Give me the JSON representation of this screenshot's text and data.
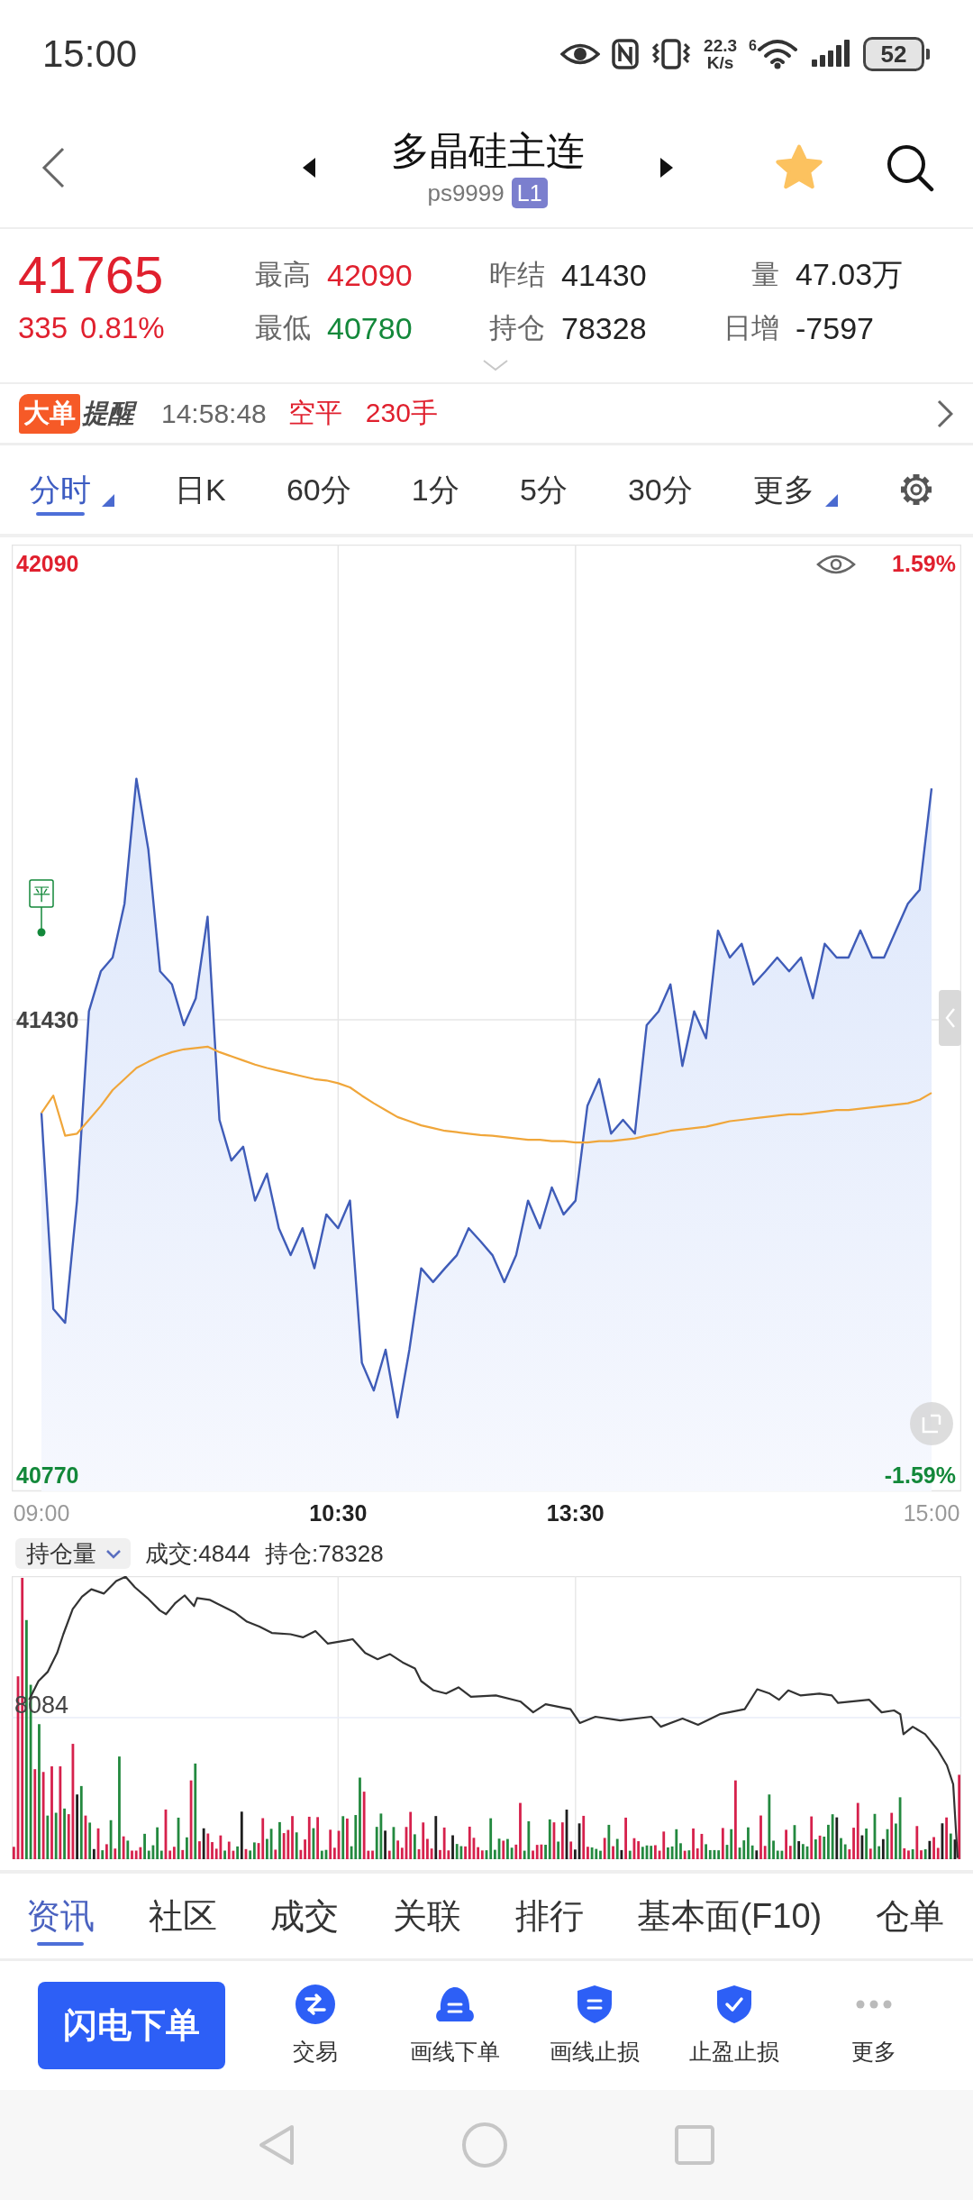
{
  "status_bar": {
    "time": "15:00",
    "network_speed": [
      "22.3",
      "K/s"
    ],
    "wifi_badge": "6",
    "battery": "52"
  },
  "header": {
    "title": "多晶硅主连",
    "code": "ps9999",
    "level_badge": "L1",
    "favorite": true
  },
  "quote": {
    "price": "41765",
    "change": "335",
    "change_percent": "0.81%",
    "color": "#e0202e",
    "stats": [
      {
        "label": "最高",
        "value": "42090",
        "color": "#e0202e"
      },
      {
        "label": "昨结",
        "value": "41430",
        "color": "#222222"
      },
      {
        "label": "量",
        "value": "47.03万",
        "color": "#222222"
      },
      {
        "label": "最低",
        "value": "40780",
        "color": "#13883a"
      },
      {
        "label": "持仓",
        "value": "78328",
        "color": "#222222"
      },
      {
        "label": "日增",
        "value": "-7597",
        "color": "#222222"
      }
    ]
  },
  "alert": {
    "logo": [
      "大单",
      "提醒"
    ],
    "time": "14:58:48",
    "action": "空平",
    "volume": "230手"
  },
  "period_tabs": [
    {
      "label": "分时",
      "selected": true,
      "has_menu": true
    },
    {
      "label": "日K",
      "selected": false,
      "has_menu": false
    },
    {
      "label": "60分",
      "selected": false,
      "has_menu": false
    },
    {
      "label": "1分",
      "selected": false,
      "has_menu": false
    },
    {
      "label": "5分",
      "selected": false,
      "has_menu": false
    },
    {
      "label": "30分",
      "selected": false,
      "has_menu": false
    },
    {
      "label": "更多",
      "selected": false,
      "has_menu": true
    }
  ],
  "intraday_chart": {
    "right_labels": [
      {
        "text": "1.59%",
        "color": "#e0202e"
      },
      {
        "text": "-1.59%",
        "color": "#13883a"
      }
    ],
    "chart_data": {
      "type": "area",
      "categories": [
        "09:00",
        null,
        null,
        null,
        null,
        null,
        null,
        null,
        null,
        null,
        null,
        null,
        null,
        null,
        null,
        null,
        null,
        null,
        null,
        null,
        null,
        null,
        null,
        null,
        null,
        "10:30",
        null,
        null,
        null,
        null,
        null,
        null,
        null,
        null,
        null,
        null,
        null,
        null,
        null,
        null,
        null,
        null,
        null,
        null,
        null,
        "13:30",
        null,
        null,
        null,
        null,
        null,
        null,
        null,
        null,
        null,
        null,
        null,
        null,
        null,
        null,
        null,
        null,
        null,
        null,
        null,
        null,
        null,
        null,
        null,
        null,
        null,
        null,
        null,
        null,
        null,
        "15:00"
      ],
      "series": [
        {
          "color": "#3f5cb8",
          "values": [
            41295,
            41011,
            40991,
            41168,
            41442,
            41500,
            41520,
            41598,
            41779,
            41677,
            41500,
            41481,
            41422,
            41461,
            41579,
            41285,
            41226,
            41246,
            41168,
            41207,
            41128,
            41089,
            41128,
            41070,
            41148,
            41128,
            41168,
            40933,
            40893,
            40952,
            40854,
            40952,
            41070,
            41050,
            41070,
            41089,
            41128,
            41109,
            41089,
            41050,
            41089,
            41168,
            41128,
            41187,
            41148,
            41168,
            41305,
            41344,
            41265,
            41285,
            41265,
            41422,
            41442,
            41481,
            41363,
            41442,
            41403,
            41559,
            41520,
            41540,
            41481,
            41500,
            41520,
            41500,
            41520,
            41461,
            41540,
            41520,
            41520,
            41559,
            41520,
            41520,
            41559,
            41598,
            41618,
            41765
          ]
        },
        {
          "type": "line",
          "color": "#f0a63a",
          "values": [
            41295,
            41320,
            41262,
            41265,
            41285,
            41305,
            41328,
            41344,
            41360,
            41369,
            41377,
            41383,
            41387,
            41389,
            41391,
            41383,
            41377,
            41371,
            41365,
            41360,
            41356,
            41352,
            41348,
            41344,
            41342,
            41338,
            41332,
            41320,
            41309,
            41299,
            41289,
            41283,
            41277,
            41273,
            41269,
            41267,
            41265,
            41263,
            41262,
            41260,
            41258,
            41256,
            41256,
            41254,
            41254,
            41252,
            41252,
            41254,
            41254,
            41256,
            41258,
            41262,
            41265,
            41269,
            41271,
            41273,
            41275,
            41279,
            41283,
            41285,
            41287,
            41289,
            41291,
            41293,
            41293,
            41295,
            41297,
            41299,
            41299,
            41301,
            41303,
            41305,
            41307,
            41309,
            41314,
            41324
          ]
        }
      ],
      "ylim": [
        40770,
        42090
      ],
      "yticks": [
        {
          "value": 42090,
          "label": "42090"
        },
        {
          "value": 41430,
          "label": "41430"
        },
        {
          "value": 40770,
          "label": "40770"
        }
      ],
      "annotations": [
        "平"
      ]
    }
  },
  "volume_panel": {
    "indicator": "持仓量",
    "readouts": [
      "成交:4844",
      "持仓:78328"
    ],
    "axis_label": "8084"
  },
  "info_tabs": [
    {
      "label": "资讯",
      "selected": true
    },
    {
      "label": "社区",
      "selected": false
    },
    {
      "label": "成交",
      "selected": false
    },
    {
      "label": "关联",
      "selected": false
    },
    {
      "label": "排行",
      "selected": false
    },
    {
      "label": "基本面(F10)",
      "selected": false
    },
    {
      "label": "仓单",
      "selected": false
    }
  ],
  "toolbar": {
    "primary_button": "闪电下单",
    "actions": [
      {
        "label": "交易",
        "kind": "trade"
      },
      {
        "label": "画线下单",
        "kind": "draw-order"
      },
      {
        "label": "画线止损",
        "kind": "draw-stop"
      },
      {
        "label": "止盈止损",
        "kind": "tp-sl"
      },
      {
        "label": "更多",
        "kind": "more"
      }
    ]
  }
}
